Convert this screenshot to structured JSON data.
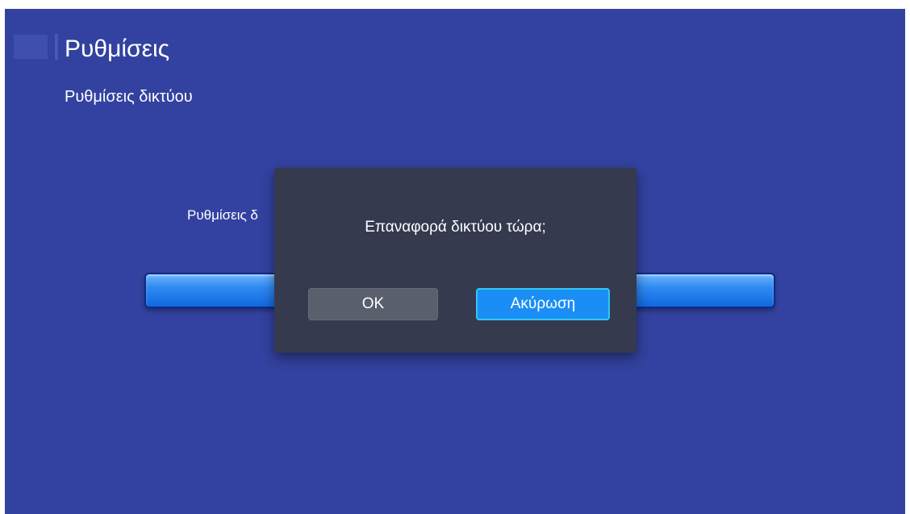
{
  "header": {
    "title": "Ρυθμίσεις",
    "logo_icon": "app-logo-icon"
  },
  "section": {
    "title": "Ρυθμίσεις δικτύου"
  },
  "background_item": {
    "label": "Ρυθμίσεις δ"
  },
  "dialog": {
    "message": "Επαναφορά δικτύου τώρα;",
    "ok_label": "OK",
    "cancel_label": "Ακύρωση",
    "focused_button": "cancel"
  },
  "colors": {
    "background": "#3342a0",
    "dialog_bg": "#353a4f",
    "accent": "#1a8ef5",
    "focus_border": "#31c8f0"
  }
}
